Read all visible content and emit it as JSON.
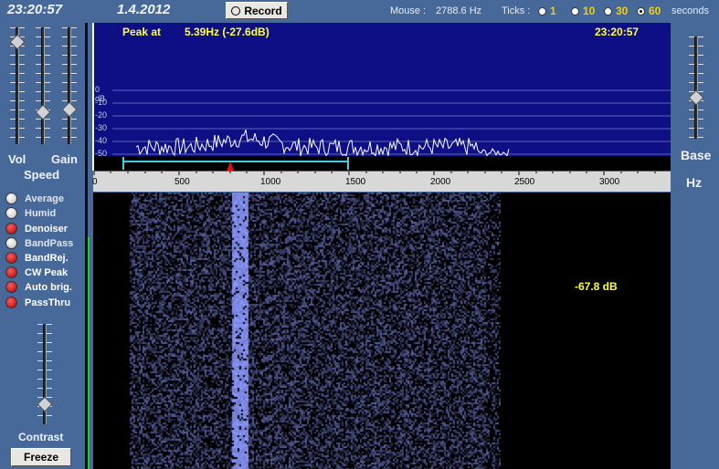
{
  "header": {
    "clock": "23:20:57",
    "date": "1.4.2012",
    "record_label": "Record",
    "mouse_label": "Mouse :",
    "mouse_value": "2788.6 Hz",
    "ticks_label": "Ticks :",
    "tick_options": [
      {
        "label": "1",
        "selected": false
      },
      {
        "label": "10",
        "selected": false
      },
      {
        "label": "30",
        "selected": false
      },
      {
        "label": "60",
        "selected": true
      }
    ],
    "seconds_label": "seconds"
  },
  "left_panel": {
    "vol_label": "Vol",
    "gain_label": "Gain",
    "speed_label": "Speed",
    "contrast_label": "Contrast",
    "freeze_label": "Freeze",
    "toggles": [
      {
        "label": "Average",
        "on": false
      },
      {
        "label": "Humid",
        "on": false
      },
      {
        "label": "Denoiser",
        "on": true
      },
      {
        "label": "BandPass",
        "on": false
      },
      {
        "label": "BandRej.",
        "on": true
      },
      {
        "label": "CW Peak",
        "on": true
      },
      {
        "label": "Auto brig.",
        "on": true
      },
      {
        "label": "PassThru",
        "on": true
      }
    ]
  },
  "spectrum": {
    "peak_label": "Peak at",
    "peak_value": "5.39Hz (-27.6dB)",
    "time": "23:20:57",
    "db_ticks": [
      "0 dB",
      "-10",
      "-20",
      "-30",
      "-40",
      "-50"
    ],
    "freq_ticks": [
      "0",
      "500",
      "1000",
      "1500",
      "2000",
      "2500",
      "3000"
    ]
  },
  "waterfall": {
    "db_readout": "-67.8 dB"
  },
  "right_panel": {
    "base_label": "Base",
    "hz_label": "Hz"
  },
  "colors": {
    "panel_bg": "#46699a",
    "spectrum_bg": "#0e0f85",
    "accent_yellow": "#ffff40",
    "filter_marker": "#40d0e0",
    "peak_marker": "#e01010"
  }
}
